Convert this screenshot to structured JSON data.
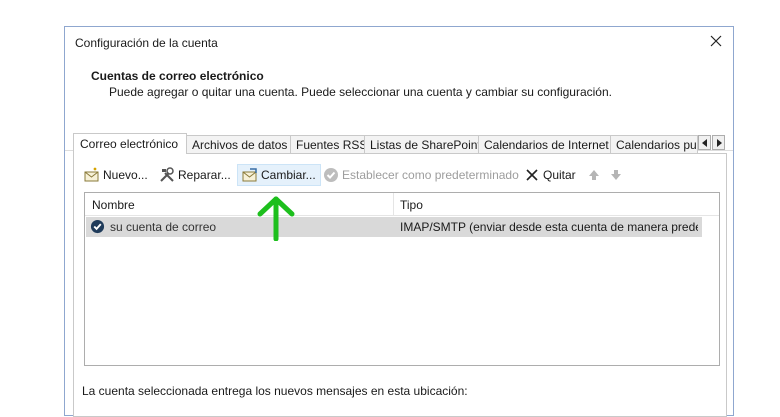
{
  "dialog": {
    "title": "Configuración de la cuenta",
    "header_title": "Cuentas de correo electrónico",
    "header_desc": "Puede agregar o quitar una cuenta. Puede seleccionar una cuenta y cambiar su configuración."
  },
  "tabs": [
    {
      "label": "Correo electrónico",
      "active": true
    },
    {
      "label": "Archivos de datos"
    },
    {
      "label": "Fuentes RSS"
    },
    {
      "label": "Listas de SharePoint"
    },
    {
      "label": "Calendarios de Internet"
    },
    {
      "label": "Calendarios pul"
    }
  ],
  "toolbar": {
    "new_label": "Nuevo...",
    "repair_label": "Reparar...",
    "change_label": "Cambiar...",
    "default_label": "Establecer como predeterminado",
    "remove_label": "Quitar"
  },
  "list": {
    "col_name": "Nombre",
    "col_type": "Tipo",
    "rows": [
      {
        "name": "su cuenta de correo",
        "type": "IMAP/SMTP (enviar desde esta cuenta de manera predet..."
      }
    ]
  },
  "footer_text": "La cuenta seleccionada entrega los nuevos mensajes en esta ubicación:",
  "colors": {
    "annotation_arrow": "#1dbf1d",
    "selected_row": "#d9d9d9",
    "hover_button": "#e5f1fb"
  }
}
